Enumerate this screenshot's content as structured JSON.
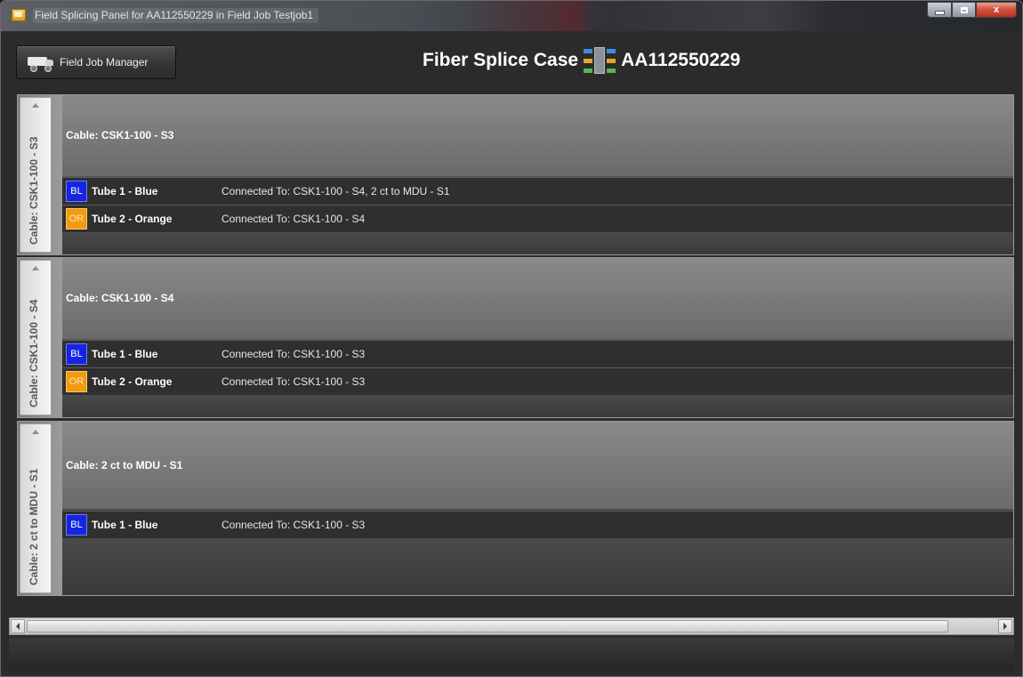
{
  "window": {
    "title": "Field Splicing Panel for AA112550229 in Field Job Testjob1",
    "close_label": "x"
  },
  "header": {
    "field_job_manager_label": "Field Job Manager",
    "title_prefix": "Fiber Splice Case",
    "case_id": "AA112550229"
  },
  "cables": [
    {
      "side_label": "Cable: CSK1-100 - S3",
      "name": "Cable: CSK1-100 - S3",
      "tubes": [
        {
          "badge": "BL",
          "color": "#1525e0",
          "name": "Tube 1 - Blue",
          "connected": "Connected To: CSK1-100 - S4, 2 ct to MDU - S1"
        },
        {
          "badge": "OR",
          "color": "#f29a11",
          "name": "Tube 2 - Orange",
          "connected": "Connected To: CSK1-100 - S4"
        }
      ]
    },
    {
      "side_label": "Cable: CSK1-100 - S4",
      "name": "Cable: CSK1-100 - S4",
      "tubes": [
        {
          "badge": "BL",
          "color": "#1525e0",
          "name": "Tube 1 - Blue",
          "connected": "Connected To: CSK1-100 - S3"
        },
        {
          "badge": "OR",
          "color": "#f29a11",
          "name": "Tube 2 - Orange",
          "connected": "Connected To: CSK1-100 - S3"
        }
      ]
    },
    {
      "side_label": "Cable: 2 ct to MDU - S1",
      "name": "Cable: 2 ct to MDU - S1",
      "tubes": [
        {
          "badge": "BL",
          "color": "#1525e0",
          "name": "Tube 1 - Blue",
          "connected": "Connected To: CSK1-100 - S3"
        }
      ]
    }
  ],
  "scrollbar": {
    "horizontal_position": 0.0,
    "horizontal_visible_fraction": 0.95
  }
}
